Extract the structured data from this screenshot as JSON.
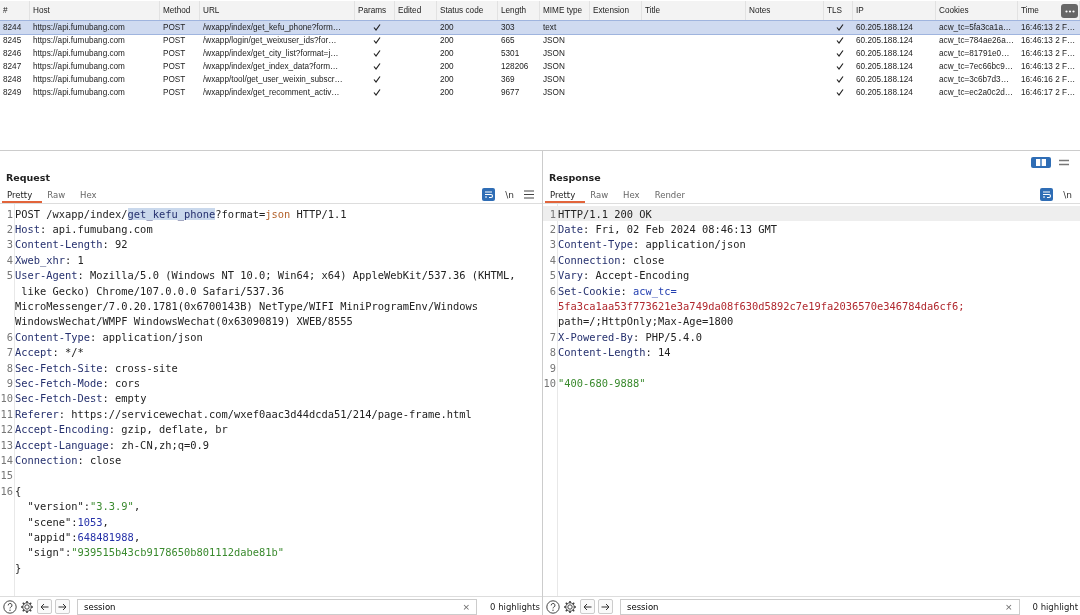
{
  "table": {
    "columns": [
      {
        "label": "#",
        "kind": "num"
      },
      {
        "label": "Host",
        "kind": "host"
      },
      {
        "label": "Method",
        "kind": "method"
      },
      {
        "label": "URL",
        "kind": "url"
      },
      {
        "label": "Params",
        "kind": "params"
      },
      {
        "label": "Edited",
        "kind": "edited"
      },
      {
        "label": "Status code",
        "kind": "status"
      },
      {
        "label": "Length",
        "kind": "length"
      },
      {
        "label": "MIME type",
        "kind": "mime"
      },
      {
        "label": "Extension",
        "kind": "extension"
      },
      {
        "label": "Title",
        "kind": "title"
      },
      {
        "label": "Notes",
        "kind": "notes"
      },
      {
        "label": "TLS",
        "kind": "tls"
      },
      {
        "label": "IP",
        "kind": "ip"
      },
      {
        "label": "Cookies",
        "kind": "cookies"
      },
      {
        "label": "Time",
        "kind": "time"
      }
    ],
    "rows": [
      {
        "num": "8244",
        "host": "https://api.fumubang.com",
        "method": "POST",
        "url": "/wxapp/index/get_kefu_phone?form…",
        "params": true,
        "status": "200",
        "length": "303",
        "mime": "text",
        "tls": true,
        "ip": "60.205.188.124",
        "cookies": "acw_tc=5fa3ca1a…",
        "time": "16:46:13 2 F…",
        "selected": true
      },
      {
        "num": "8245",
        "host": "https://api.fumubang.com",
        "method": "POST",
        "url": "/wxapp/login/get_weixuser_ids?for…",
        "params": true,
        "status": "200",
        "length": "665",
        "mime": "JSON",
        "tls": true,
        "ip": "60.205.188.124",
        "cookies": "acw_tc=784ae26a…",
        "time": "16:46:13 2 F…",
        "selected": false
      },
      {
        "num": "8246",
        "host": "https://api.fumubang.com",
        "method": "POST",
        "url": "/wxapp/index/get_city_list?format=j…",
        "params": true,
        "status": "200",
        "length": "5301",
        "mime": "JSON",
        "tls": true,
        "ip": "60.205.188.124",
        "cookies": "acw_tc=81791e0…",
        "time": "16:46:13 2 F…",
        "selected": false
      },
      {
        "num": "8247",
        "host": "https://api.fumubang.com",
        "method": "POST",
        "url": "/wxapp/index/get_index_data?form…",
        "params": true,
        "status": "200",
        "length": "128206",
        "mime": "JSON",
        "tls": true,
        "ip": "60.205.188.124",
        "cookies": "acw_tc=7ec66bc9…",
        "time": "16:46:13 2 F…",
        "selected": false
      },
      {
        "num": "8248",
        "host": "https://api.fumubang.com",
        "method": "POST",
        "url": "/wxapp/tool/get_user_weixin_subscr…",
        "params": true,
        "status": "200",
        "length": "369",
        "mime": "JSON",
        "tls": true,
        "ip": "60.205.188.124",
        "cookies": "acw_tc=3c6b7d3…",
        "time": "16:46:16 2 F…",
        "selected": false
      },
      {
        "num": "8249",
        "host": "https://api.fumubang.com",
        "method": "POST",
        "url": "/wxapp/index/get_recomment_activ…",
        "params": true,
        "status": "200",
        "length": "9677",
        "mime": "JSON",
        "tls": true,
        "ip": "60.205.188.124",
        "cookies": "acw_tc=ec2a0c2d…",
        "time": "16:46:17 2 F…",
        "selected": false
      }
    ]
  },
  "request": {
    "title": "Request",
    "tabs": [
      {
        "label": "Pretty",
        "selected": true
      },
      {
        "label": "Raw",
        "selected": false
      },
      {
        "label": "Hex",
        "selected": false
      }
    ],
    "newline_toggle": "\\n",
    "rows": [
      {
        "no": "1",
        "tokens": [
          {
            "kind": "text",
            "text": "POST /wxapp/index/"
          },
          {
            "kind": "hl",
            "text": "get_kefu_phone"
          },
          {
            "kind": "text",
            "text": "?format="
          },
          {
            "kind": "value",
            "text": "json"
          },
          {
            "kind": "text",
            "text": " HTTP/1.1"
          }
        ]
      },
      {
        "no": "2",
        "tokens": [
          {
            "kind": "key",
            "text": "Host"
          },
          {
            "kind": "text",
            "text": ": api.fumubang.com"
          }
        ]
      },
      {
        "no": "3",
        "tokens": [
          {
            "kind": "key",
            "text": "Content-Length"
          },
          {
            "kind": "text",
            "text": ": 92"
          }
        ]
      },
      {
        "no": "4",
        "tokens": [
          {
            "kind": "key",
            "text": "Xweb_xhr"
          },
          {
            "kind": "text",
            "text": ": 1"
          }
        ]
      },
      {
        "no": "5",
        "tokens": [
          {
            "kind": "key",
            "text": "User-Agent"
          },
          {
            "kind": "text",
            "text": ": Mozilla/5.0 (Windows NT 10.0; Win64; x64) AppleWebKit/537.36 (KHTML,"
          }
        ]
      },
      {
        "tokens": [
          {
            "kind": "text",
            "text": " like Gecko) Chrome/107.0.0.0 Safari/537.36"
          }
        ]
      },
      {
        "tokens": [
          {
            "kind": "text",
            "text": "MicroMessenger/7.0.20.1781(0x6700143B) NetType/WIFI MiniProgramEnv/Windows"
          }
        ]
      },
      {
        "tokens": [
          {
            "kind": "text",
            "text": "WindowsWechat/WMPF WindowsWechat(0x63090819) XWEB/8555"
          }
        ]
      },
      {
        "no": "6",
        "tokens": [
          {
            "kind": "key",
            "text": "Content-Type"
          },
          {
            "kind": "text",
            "text": ": application/json"
          }
        ]
      },
      {
        "no": "7",
        "tokens": [
          {
            "kind": "key",
            "text": "Accept"
          },
          {
            "kind": "text",
            "text": ": */*"
          }
        ]
      },
      {
        "no": "8",
        "tokens": [
          {
            "kind": "key",
            "text": "Sec-Fetch-Site"
          },
          {
            "kind": "text",
            "text": ": cross-site"
          }
        ]
      },
      {
        "no": "9",
        "tokens": [
          {
            "kind": "key",
            "text": "Sec-Fetch-Mode"
          },
          {
            "kind": "text",
            "text": ": cors"
          }
        ]
      },
      {
        "no": "10",
        "tokens": [
          {
            "kind": "key",
            "text": "Sec-Fetch-Dest"
          },
          {
            "kind": "text",
            "text": ": empty"
          }
        ]
      },
      {
        "no": "11",
        "tokens": [
          {
            "kind": "key",
            "text": "Referer"
          },
          {
            "kind": "text",
            "text": ": https://servicewechat.com/wxef0aac3d44dcda51/214/page-frame.html"
          }
        ]
      },
      {
        "no": "12",
        "tokens": [
          {
            "kind": "key",
            "text": "Accept-Encoding"
          },
          {
            "kind": "text",
            "text": ": gzip, deflate, br"
          }
        ]
      },
      {
        "no": "13",
        "tokens": [
          {
            "kind": "key",
            "text": "Accept-Language"
          },
          {
            "kind": "text",
            "text": ": zh-CN,zh;q=0.9"
          }
        ]
      },
      {
        "no": "14",
        "tokens": [
          {
            "kind": "key",
            "text": "Connection"
          },
          {
            "kind": "text",
            "text": ": close"
          }
        ]
      },
      {
        "no": "15",
        "tokens": []
      },
      {
        "no": "16",
        "tokens": [
          {
            "kind": "text",
            "text": "{"
          }
        ]
      },
      {
        "tokens": [
          {
            "kind": "text",
            "text": "  \"version\":"
          },
          {
            "kind": "str",
            "text": "\"3.3.9\""
          },
          {
            "kind": "text",
            "text": ","
          }
        ]
      },
      {
        "tokens": [
          {
            "kind": "text",
            "text": "  \"scene\":"
          },
          {
            "kind": "num",
            "text": "1053"
          },
          {
            "kind": "text",
            "text": ","
          }
        ]
      },
      {
        "tokens": [
          {
            "kind": "text",
            "text": "  \"appid\":"
          },
          {
            "kind": "num",
            "text": "648481988"
          },
          {
            "kind": "text",
            "text": ","
          }
        ]
      },
      {
        "tokens": [
          {
            "kind": "text",
            "text": "  \"sign\":"
          },
          {
            "kind": "str",
            "text": "\"939515b43cb9178650b801112dabe81b\""
          }
        ]
      },
      {
        "tokens": [
          {
            "kind": "text",
            "text": "}"
          }
        ]
      }
    ],
    "search": {
      "value": "session",
      "clear": "×",
      "highlights": "0 highlights"
    }
  },
  "response": {
    "title": "Response",
    "tabs": [
      {
        "label": "Pretty",
        "selected": true
      },
      {
        "label": "Raw",
        "selected": false
      },
      {
        "label": "Hex",
        "selected": false
      },
      {
        "label": "Render",
        "selected": false
      }
    ],
    "newline_toggle": "\\n",
    "rows": [
      {
        "no": "1",
        "current": true,
        "tokens": [
          {
            "kind": "text",
            "text": "HTTP/1.1 200 OK"
          }
        ]
      },
      {
        "no": "2",
        "current": false,
        "tokens": [
          {
            "kind": "key",
            "text": "Date"
          },
          {
            "kind": "text",
            "text": ": Fri, 02 Feb 2024 08:46:13 GMT"
          }
        ]
      },
      {
        "no": "3",
        "current": false,
        "tokens": [
          {
            "kind": "key",
            "text": "Content-Type"
          },
          {
            "kind": "text",
            "text": ": application/json"
          }
        ]
      },
      {
        "no": "4",
        "current": false,
        "tokens": [
          {
            "kind": "key",
            "text": "Connection"
          },
          {
            "kind": "text",
            "text": ": close"
          }
        ]
      },
      {
        "no": "5",
        "current": false,
        "tokens": [
          {
            "kind": "key",
            "text": "Vary"
          },
          {
            "kind": "text",
            "text": ": Accept-Encoding"
          }
        ]
      },
      {
        "no": "6",
        "current": false,
        "tokens": [
          {
            "kind": "key",
            "text": "Set-Cookie"
          },
          {
            "kind": "text",
            "text": ": "
          },
          {
            "kind": "name",
            "text": "acw_tc="
          }
        ]
      },
      {
        "current": false,
        "tokens": [
          {
            "kind": "cookie",
            "text": "5fa3ca1aa53f773621e3a749da08f630d5892c7e19fa2036570e346784da6cf6;"
          }
        ]
      },
      {
        "current": false,
        "tokens": [
          {
            "kind": "text",
            "text": "path=/;HttpOnly;Max-Age=1800"
          }
        ]
      },
      {
        "no": "7",
        "current": false,
        "tokens": [
          {
            "kind": "key",
            "text": "X-Powered-By"
          },
          {
            "kind": "text",
            "text": ": PHP/5.4.0"
          }
        ]
      },
      {
        "no": "8",
        "current": false,
        "tokens": [
          {
            "kind": "key",
            "text": "Content-Length"
          },
          {
            "kind": "text",
            "text": ": 14"
          }
        ]
      },
      {
        "no": "9",
        "current": false,
        "tokens": []
      },
      {
        "no": "10",
        "current": false,
        "tokens": [
          {
            "kind": "str",
            "text": "\"400-680-9888\""
          }
        ]
      }
    ],
    "search": {
      "value": "session",
      "clear": "×",
      "highlights": "0 highlight"
    }
  }
}
